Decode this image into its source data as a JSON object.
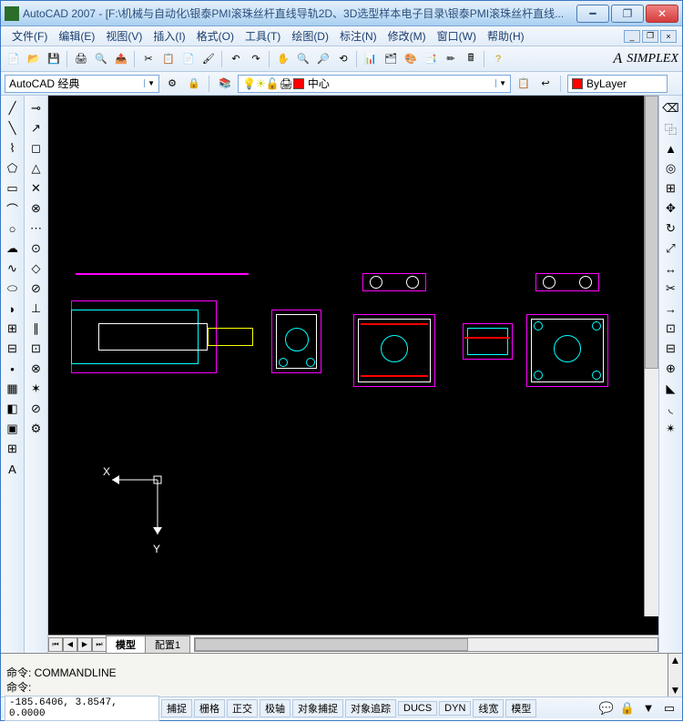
{
  "title": "AutoCAD 2007 - [F:\\机械与自动化\\银泰PMI滚珠丝杆直线导轨2D、3D选型样本电子目录\\银泰PMI滚珠丝杆直线...",
  "menu": [
    "文件(F)",
    "编辑(E)",
    "视图(V)",
    "插入(I)",
    "格式(O)",
    "工具(T)",
    "绘图(D)",
    "标注(N)",
    "修改(M)",
    "窗口(W)",
    "帮助(H)"
  ],
  "workspace": "AutoCAD 经典",
  "layer_combo": "中心",
  "bylayer": "ByLayer",
  "style_text": "SIMPLEX",
  "tabs": {
    "model": "模型",
    "layout1": "配置1"
  },
  "ucs": {
    "x": "X",
    "y": "Y"
  },
  "cmd": {
    "line1": "命令: COMMANDLINE",
    "line2": "命令:"
  },
  "coords": "-185.6406, 3.8547, 0.0000",
  "status": [
    "捕捉",
    "栅格",
    "正交",
    "极轴",
    "对象捕捉",
    "对象追踪",
    "DUCS",
    "DYN",
    "线宽",
    "模型"
  ]
}
